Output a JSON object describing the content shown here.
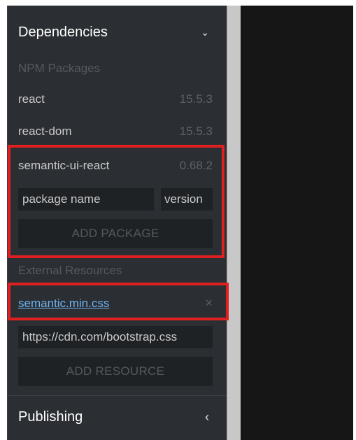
{
  "sidebar": {
    "dependencies": {
      "title": "Dependencies",
      "npm_heading": "NPM Packages",
      "packages": [
        {
          "name": "react",
          "version": "15.5.3"
        },
        {
          "name": "react-dom",
          "version": "15.5.3"
        },
        {
          "name": "semantic-ui-react",
          "version": "0.68.2"
        }
      ],
      "package_name_placeholder": "package name",
      "version_placeholder": "version",
      "add_package_label": "ADD PACKAGE",
      "external_heading": "External Resources",
      "resources": [
        {
          "name": "semantic.min.css"
        }
      ],
      "resource_placeholder": "https://cdn.com/bootstrap.css",
      "add_resource_label": "ADD RESOURCE"
    },
    "publishing": {
      "title": "Publishing"
    }
  },
  "icons": {
    "expanded_chevron": "⌄",
    "collapsed_chevron": "‹",
    "remove": "×"
  },
  "colors": {
    "highlight": "#e02020",
    "link": "#6fb3f0",
    "sidebar_bg": "#2b2f33"
  }
}
